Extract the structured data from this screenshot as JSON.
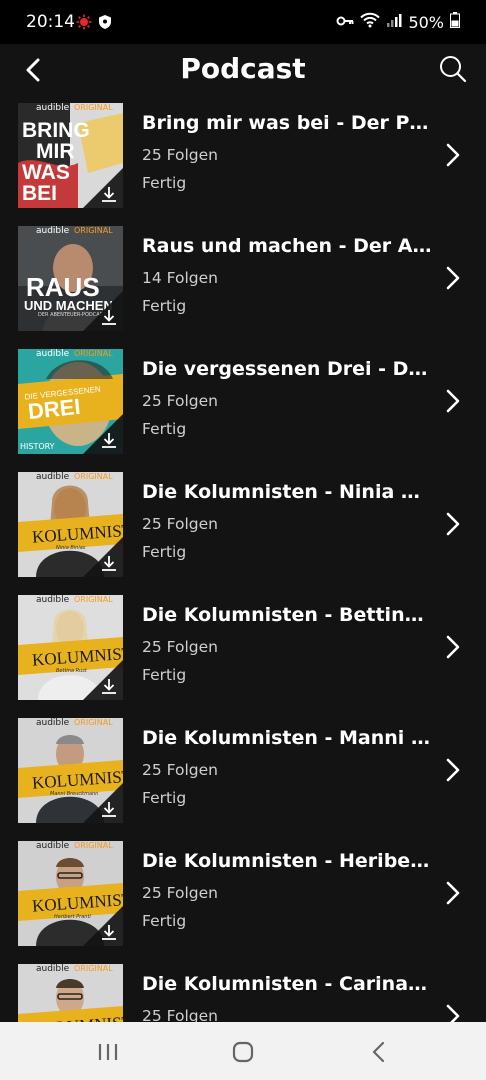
{
  "status_bar": {
    "time": "20:14",
    "battery": "50%",
    "icons": [
      "notification-dot-icon",
      "shield-icon",
      "key-icon",
      "wifi-icon",
      "signal-icon",
      "battery-icon"
    ]
  },
  "header": {
    "title": "Podcast",
    "back_icon": "back-arrow-icon",
    "search_icon": "search-icon"
  },
  "cover_brand": {
    "audible": "audible",
    "original": "ORIGINAL"
  },
  "items": [
    {
      "title": "Bring mir was bei - Der Podcast",
      "count": "25 Folgen",
      "status": "Fertig",
      "cover_text": "BRING MIR WAS BEI",
      "cover_sub": ""
    },
    {
      "title": "Raus und machen - Der Abenteuer-Podcast",
      "count": "14 Folgen",
      "status": "Fertig",
      "cover_text": "RAUS UND MACHEN",
      "cover_sub": "DER ABENTEUER-PODCAST"
    },
    {
      "title": "Die vergessenen Drei - Der Podcast",
      "count": "25 Folgen",
      "status": "Fertig",
      "cover_text": "DIE VERGESSENEN DREI",
      "cover_sub": "HISTORY"
    },
    {
      "title": "Die Kolumnisten - Ninia Binias",
      "count": "25 Folgen",
      "status": "Fertig",
      "cover_text": "KOLUMNISTEN",
      "cover_sub": "Ninia Binias"
    },
    {
      "title": "Die Kolumnisten - Bettina Rust",
      "count": "25 Folgen",
      "status": "Fertig",
      "cover_text": "KOLUMNISTEN",
      "cover_sub": "Bettina Rust"
    },
    {
      "title": "Die Kolumnisten - Manni Breuckmann",
      "count": "25 Folgen",
      "status": "Fertig",
      "cover_text": "KOLUMNISTEN",
      "cover_sub": "Manni Breuckmann"
    },
    {
      "title": "Die Kolumnisten - Heribert Prantl",
      "count": "25 Folgen",
      "status": "Fertig",
      "cover_text": "KOLUMNISTEN",
      "cover_sub": "Heribert Prantl"
    },
    {
      "title": "Die Kolumnisten - Carina Konrad",
      "count": "25 Folgen",
      "status": "",
      "cover_text": "KOLUMNISTEN",
      "cover_sub": ""
    }
  ],
  "nav_bar": {
    "recents_icon": "recents-icon",
    "home_icon": "home-icon",
    "back_icon": "nav-back-icon"
  },
  "colors": {
    "background": "#131313",
    "status_bar": "#000000",
    "text_secondary": "#cfcfcf",
    "audible_orange": "#f7991c",
    "kolumnisten_yellow": "#e8b21e",
    "teal": "#2aa5a0",
    "nav_bar": "#f2f2f2"
  }
}
